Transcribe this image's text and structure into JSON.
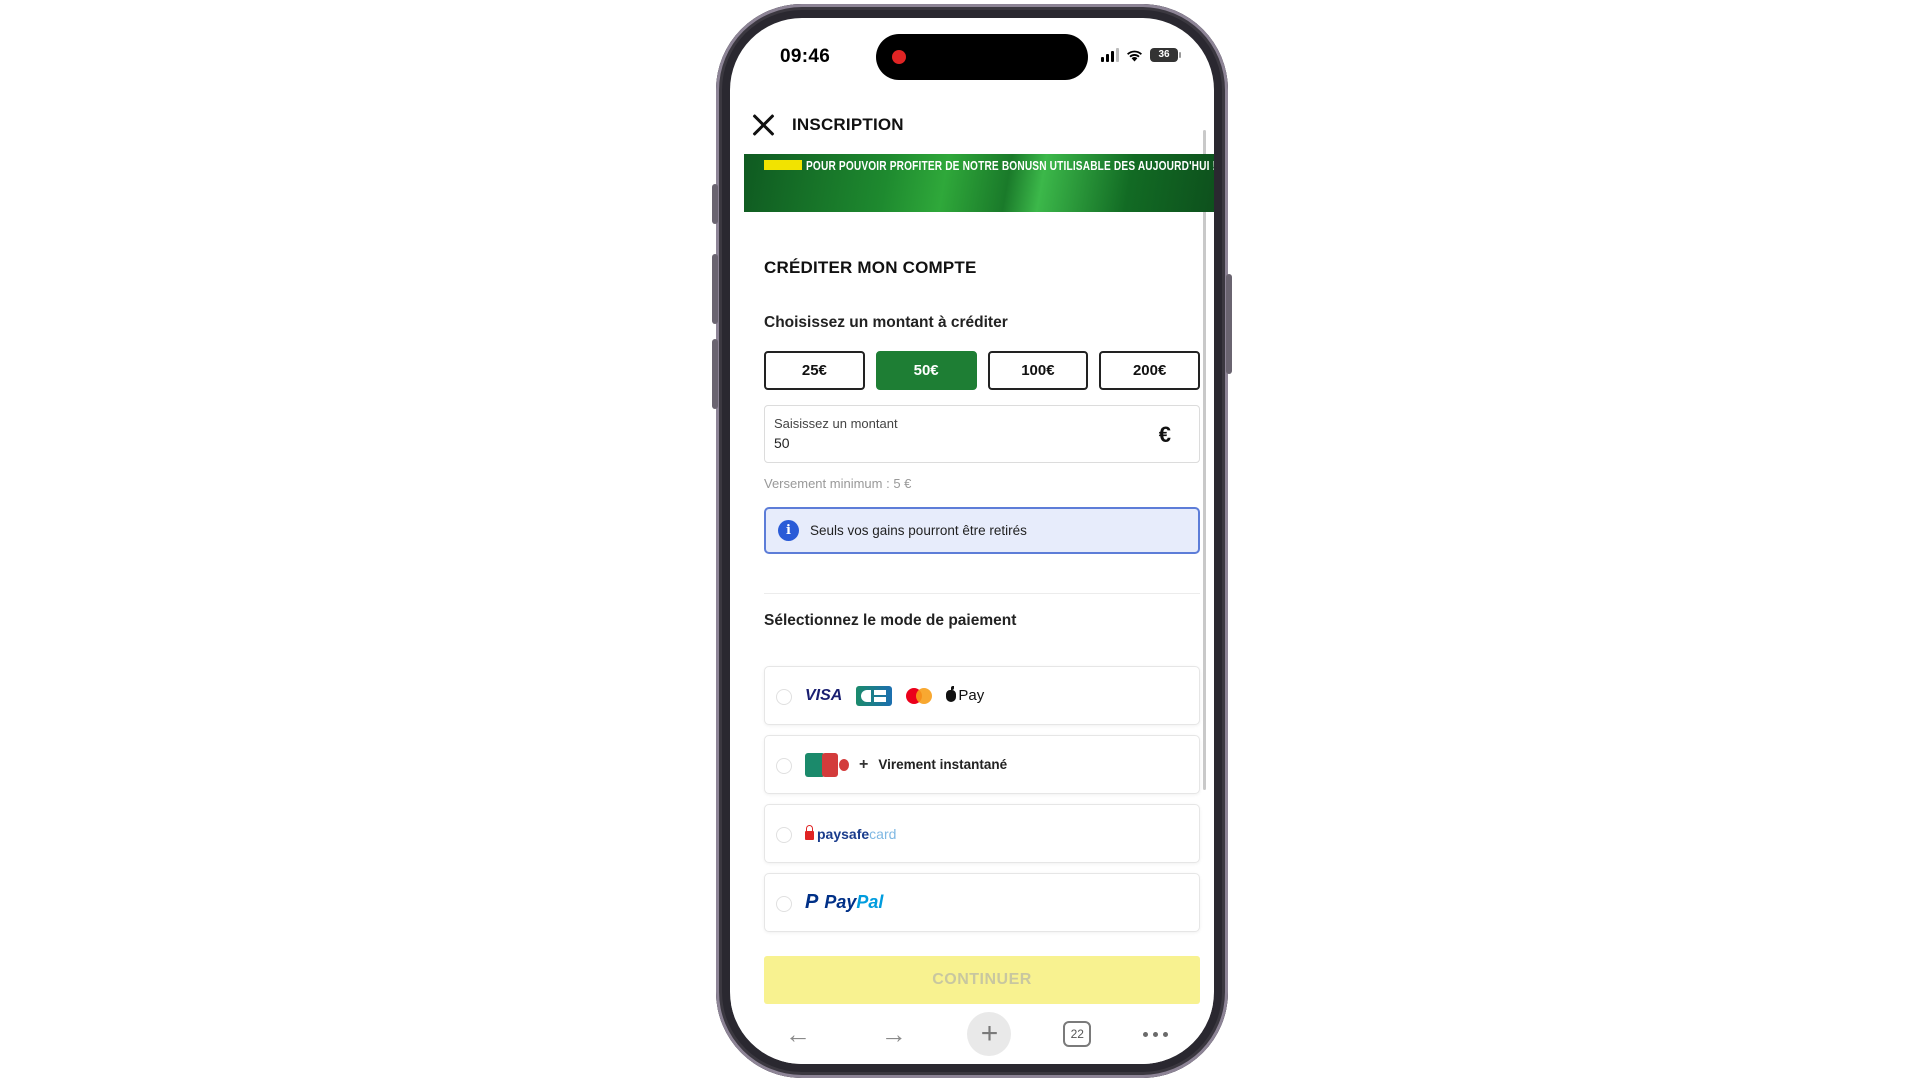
{
  "status_bar": {
    "time": "09:46",
    "battery": "36"
  },
  "header": {
    "title": "INSCRIPTION"
  },
  "banner": {
    "text": "POUR POUVOIR PROFITER DE NOTRE BONUSN UTILISABLE DES AUJOURD'HUI !"
  },
  "section": {
    "title": "CRÉDITER MON COMPTE"
  },
  "amount": {
    "label": "Choisissez un montant à créditer",
    "options": [
      "25€",
      "50€",
      "100€",
      "200€"
    ],
    "selected": "50€",
    "field_label": "Saisissez un montant",
    "field_value": "50",
    "currency": "€",
    "minimum_note": "Versement minimum : 5 €"
  },
  "info": {
    "text": "Seuls vos gains pourront être retirés"
  },
  "payment": {
    "title": "Sélectionnez le mode de paiement",
    "cards": {
      "visa": "VISA",
      "applepay": "Pay"
    },
    "bank": {
      "plus": "+",
      "label": "Virement instantané"
    },
    "paysafe": {
      "part1": "paysafe",
      "part2": "card"
    },
    "paypal": {
      "mark": "P",
      "part1": "Pay",
      "part2": "Pal"
    }
  },
  "continue_label": "CONTINUER",
  "toolbar": {
    "tabs_count": "22",
    "back": "←",
    "forward": "→",
    "new": "+"
  },
  "colors": {
    "brand_green": "#1e7e34",
    "cta_yellow": "#f8f290",
    "info_blue": "#2a5bd7"
  }
}
